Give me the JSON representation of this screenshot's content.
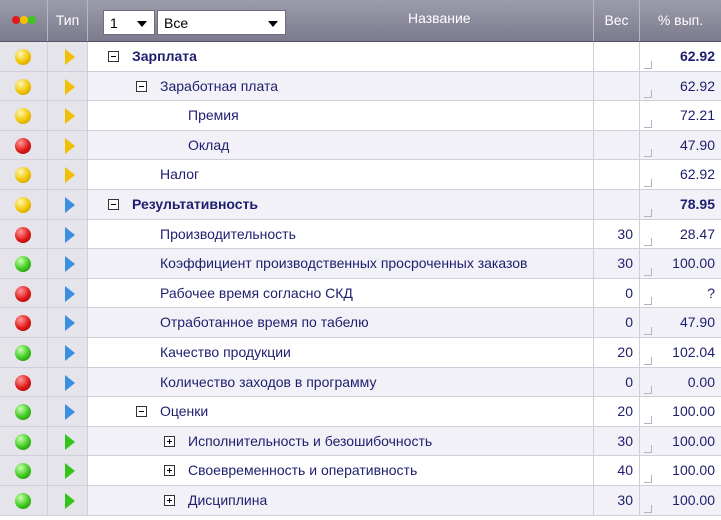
{
  "header": {
    "type_label": "Тип",
    "level_value": "1",
    "filter_value": "Все",
    "name_label": "Название",
    "weight_label": "Вес",
    "pct_label": "% вып.",
    "dot_colors": [
      "#e01818",
      "#f2c400",
      "#3cc81e"
    ]
  },
  "rows": [
    {
      "status": "yellow",
      "type": "yellow",
      "name": "Зарплата",
      "level": 0,
      "expander": "minus",
      "bold": true,
      "weight": "",
      "pct": "62.92"
    },
    {
      "status": "yellow",
      "type": "yellow",
      "name": "Заработная плата",
      "level": 1,
      "expander": "minus",
      "bold": false,
      "weight": "",
      "pct": "62.92"
    },
    {
      "status": "yellow",
      "type": "yellow",
      "name": "Премия",
      "level": 2,
      "expander": "",
      "bold": false,
      "weight": "",
      "pct": "72.21"
    },
    {
      "status": "red",
      "type": "yellow",
      "name": "Оклад",
      "level": 2,
      "expander": "",
      "bold": false,
      "weight": "",
      "pct": "47.90"
    },
    {
      "status": "yellow",
      "type": "yellow",
      "name": "Налог",
      "level": 1,
      "expander": "",
      "bold": false,
      "weight": "",
      "pct": "62.92"
    },
    {
      "status": "yellow",
      "type": "blue",
      "name": "Результативность",
      "level": 0,
      "expander": "minus",
      "bold": true,
      "weight": "",
      "pct": "78.95"
    },
    {
      "status": "red",
      "type": "blue",
      "name": "Производительность",
      "level": 1,
      "expander": "",
      "bold": false,
      "weight": "30",
      "pct": "28.47"
    },
    {
      "status": "green",
      "type": "blue",
      "name": "Коэффициент производственных просроченных заказов",
      "level": 1,
      "expander": "",
      "bold": false,
      "weight": "30",
      "pct": "100.00"
    },
    {
      "status": "red",
      "type": "blue",
      "name": "Рабочее время согласно СКД",
      "level": 1,
      "expander": "",
      "bold": false,
      "weight": "0",
      "pct": "?"
    },
    {
      "status": "red",
      "type": "blue",
      "name": "Отработанное время по табелю",
      "level": 1,
      "expander": "",
      "bold": false,
      "weight": "0",
      "pct": "47.90"
    },
    {
      "status": "green",
      "type": "blue",
      "name": "Качество продукции",
      "level": 1,
      "expander": "",
      "bold": false,
      "weight": "20",
      "pct": "102.04"
    },
    {
      "status": "red",
      "type": "blue",
      "name": "Количество заходов в программу",
      "level": 1,
      "expander": "",
      "bold": false,
      "weight": "0",
      "pct": "0.00"
    },
    {
      "status": "green",
      "type": "blue",
      "name": "Оценки",
      "level": 1,
      "expander": "minus",
      "bold": false,
      "weight": "20",
      "pct": "100.00"
    },
    {
      "status": "green",
      "type": "green",
      "name": "Исполнительность и безошибочность",
      "level": 2,
      "expander": "plus",
      "bold": false,
      "weight": "30",
      "pct": "100.00"
    },
    {
      "status": "green",
      "type": "green",
      "name": "Своевременность и оперативность",
      "level": 2,
      "expander": "plus",
      "bold": false,
      "weight": "40",
      "pct": "100.00"
    },
    {
      "status": "green",
      "type": "green",
      "name": "Дисциплина",
      "level": 2,
      "expander": "plus",
      "bold": false,
      "weight": "30",
      "pct": "100.00"
    }
  ]
}
